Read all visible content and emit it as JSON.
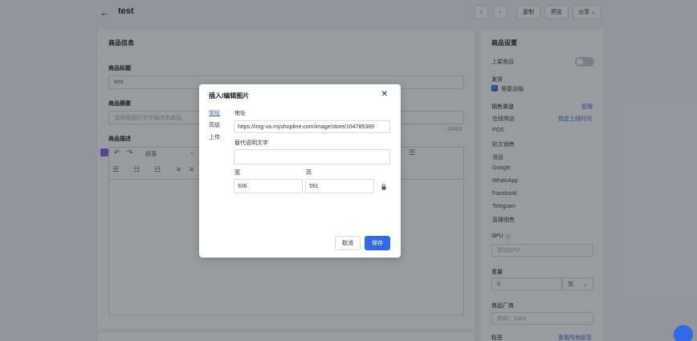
{
  "header": {
    "title": "test",
    "copy": "复制",
    "preview": "预览",
    "share": "分享"
  },
  "main": {
    "section_title": "商品信息",
    "name_label": "商品标题",
    "name_value": "test",
    "summary_label": "商品摘要",
    "summary_placeholder": "请用简短的文字描述本商品",
    "counter": "0/400",
    "desc_label": "商品描述",
    "paragraph_select": "段落"
  },
  "side": {
    "title": "商品设置",
    "listed": "上架商品",
    "shipping_label": "发货",
    "shipping_check": "需要运输",
    "channels_label": "销售渠道",
    "channels_manage": "管理",
    "channels_schedule": "指定上线时间",
    "channels": [
      "在线商店",
      "POS",
      "贴文销售",
      "消息",
      "Google",
      "WhatsApp",
      "Facebook",
      "Telegram",
      "直播销售"
    ],
    "spu_label": "SPU",
    "spu_placeholder": "添加SPU",
    "weight_label": "重量",
    "weight_value": "0",
    "weight_unit": "克",
    "vendor_label": "商品厂商",
    "vendor_placeholder": "例如：Zara",
    "tags_label": "标签",
    "tags_link": "查看所有标签"
  },
  "modal": {
    "title": "插入/编辑图片",
    "tabs": [
      "常规",
      "高级",
      "上传"
    ],
    "url_label": "地址",
    "url_value": "https://img-va.myshopline.com/image/store/164785389",
    "alt_label": "替代说明文字",
    "alt_value": "",
    "width_label": "宽",
    "width_value": "936",
    "height_label": "高",
    "height_value": "591",
    "cancel": "取消",
    "save": "保存"
  }
}
